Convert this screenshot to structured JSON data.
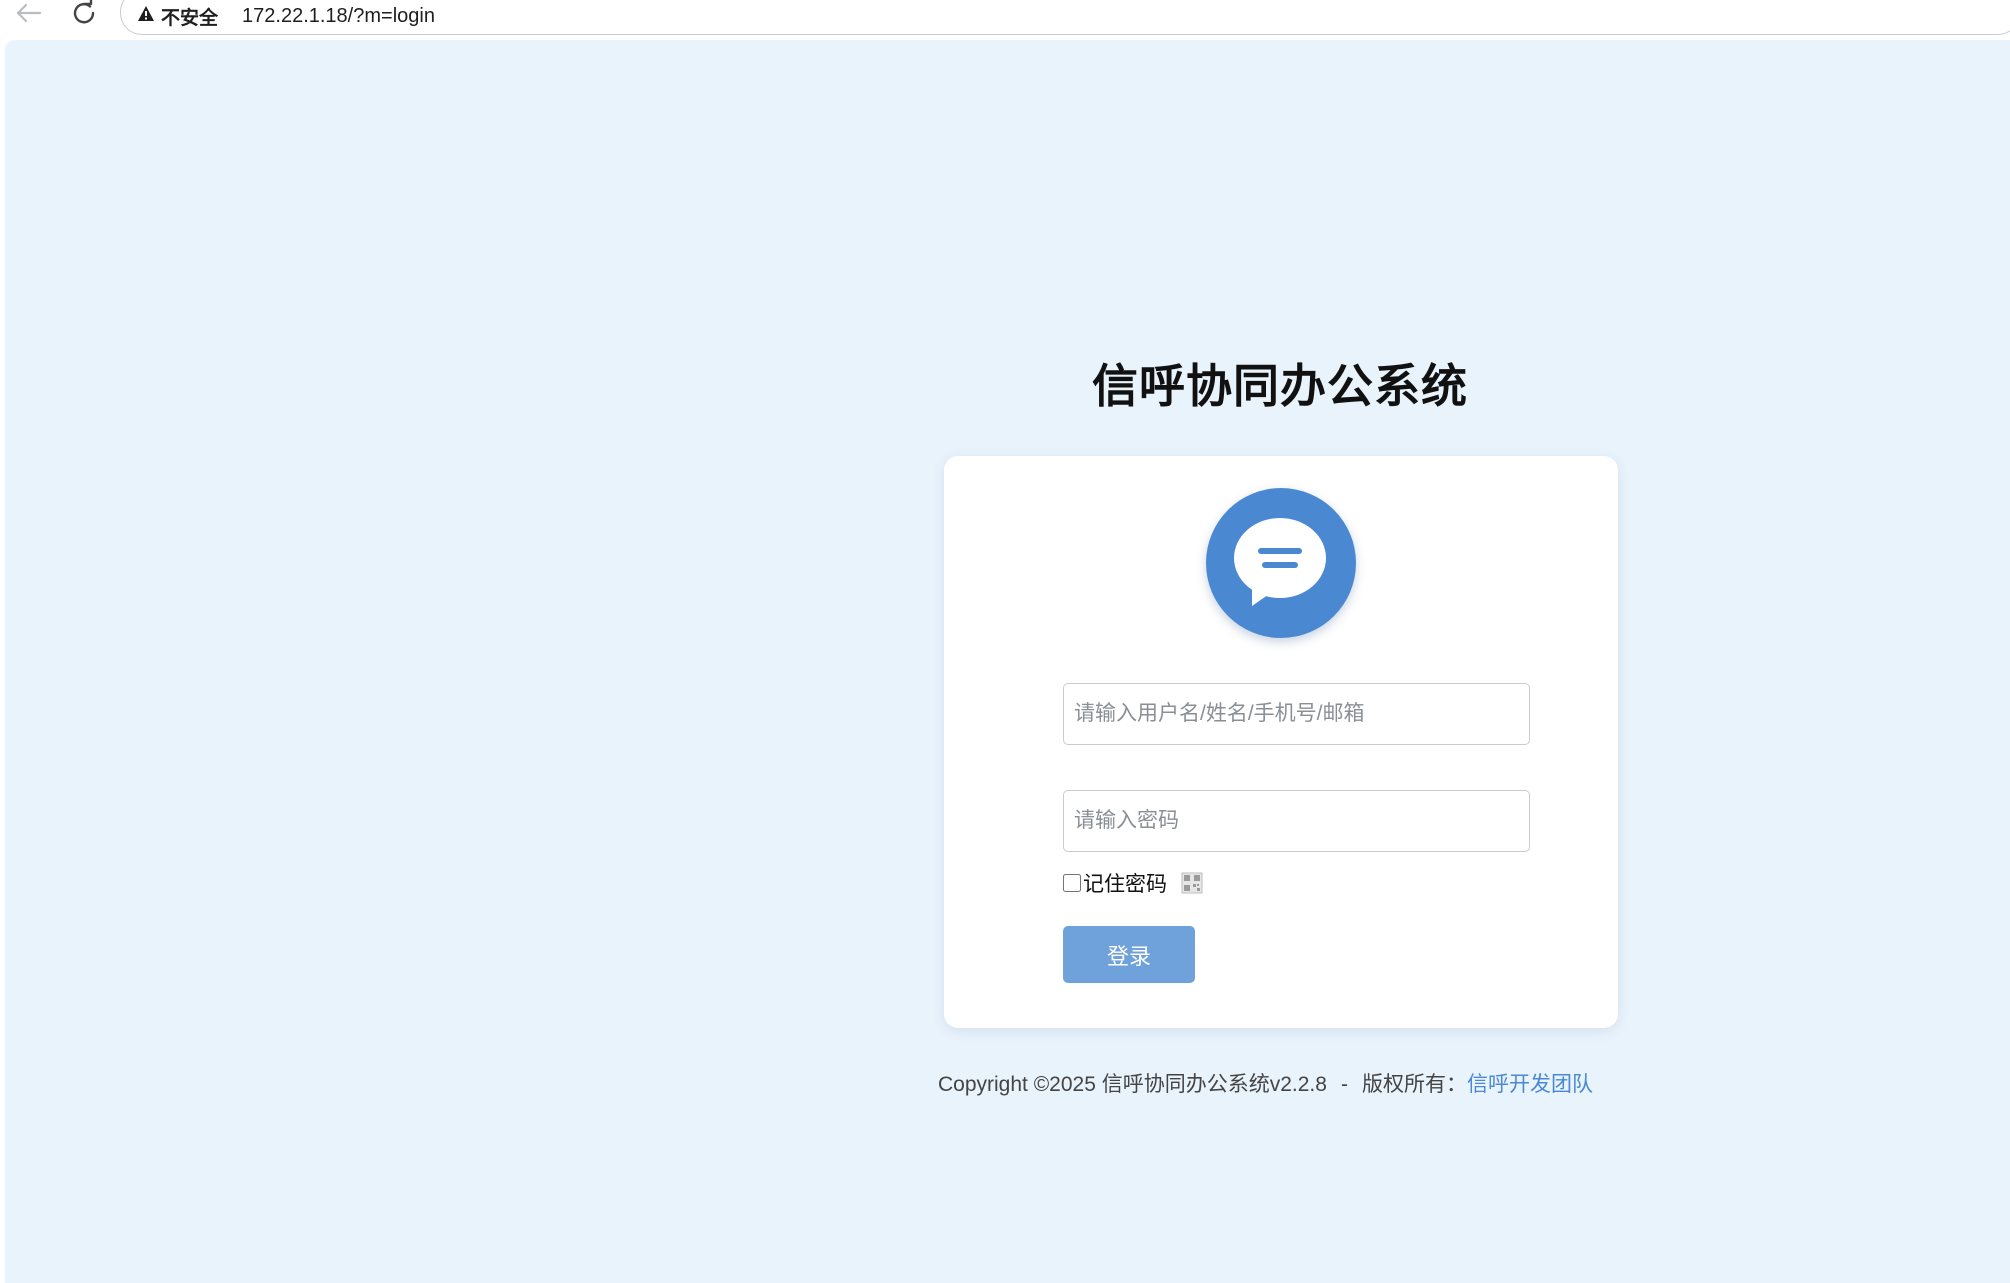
{
  "browser": {
    "security_label": "不安全",
    "url": "172.22.1.18/?m=login"
  },
  "login": {
    "title": "信呼协同办公系统",
    "username_placeholder": "请输入用户名/姓名/手机号/邮箱",
    "password_placeholder": "请输入密码",
    "remember_label": "记住密码",
    "submit_label": "登录"
  },
  "footer": {
    "copyright": "Copyright ©2025 信呼协同办公系统v2.2.8",
    "separator": "-",
    "rights_label": "版权所有：",
    "team_link": "信呼开发团队"
  },
  "colors": {
    "background": "#e9f3fc",
    "brand": "#4a89d2",
    "button": "#6fa2db"
  },
  "icons": {
    "back": "arrow-left-icon",
    "reload": "reload-icon",
    "security": "warning-triangle-icon",
    "logo": "chat-bubble-icon",
    "qrcode": "qrcode-icon"
  }
}
